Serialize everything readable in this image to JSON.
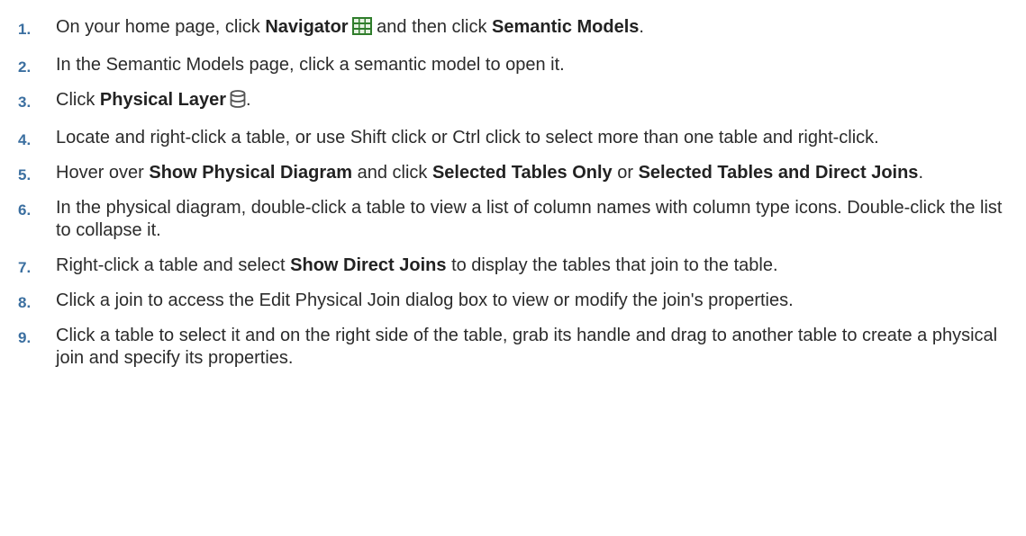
{
  "icons": {
    "navigator": "navigator-grid-icon",
    "physical_layer": "physical-layer-database-icon"
  },
  "colors": {
    "step_number": "#3b6fa0",
    "navigator_icon": "#2f7d2b",
    "text": "#2b2b2b"
  },
  "steps": [
    {
      "num": "1.",
      "parts": [
        "On your home page, click ",
        "Navigator",
        " and then click ",
        "Semantic Models",
        "."
      ]
    },
    {
      "num": "2.",
      "text": "In the Semantic Models page, click a semantic model to open it."
    },
    {
      "num": "3.",
      "parts": [
        "Click ",
        "Physical Layer",
        "."
      ]
    },
    {
      "num": "4.",
      "text": "Locate and right-click a table, or use Shift click or Ctrl click to select more than one table and right-click."
    },
    {
      "num": "5.",
      "parts": [
        "Hover over ",
        "Show Physical Diagram",
        " and click ",
        "Selected Tables Only",
        " or ",
        "Selected Tables and Direct Joins",
        "."
      ]
    },
    {
      "num": "6.",
      "text": "In the physical diagram, double-click a table to view a list of column names with column type icons. Double-click the list to collapse it."
    },
    {
      "num": "7.",
      "parts": [
        "Right-click a table and select ",
        "Show Direct Joins",
        " to display the tables that join to the table."
      ]
    },
    {
      "num": "8.",
      "text": "Click a join to access the Edit Physical Join dialog box to view or modify the join's properties."
    },
    {
      "num": "9.",
      "text": "Click a table to select it and on the right side of the table, grab its handle and drag to another table to create a physical join and specify its properties."
    }
  ]
}
